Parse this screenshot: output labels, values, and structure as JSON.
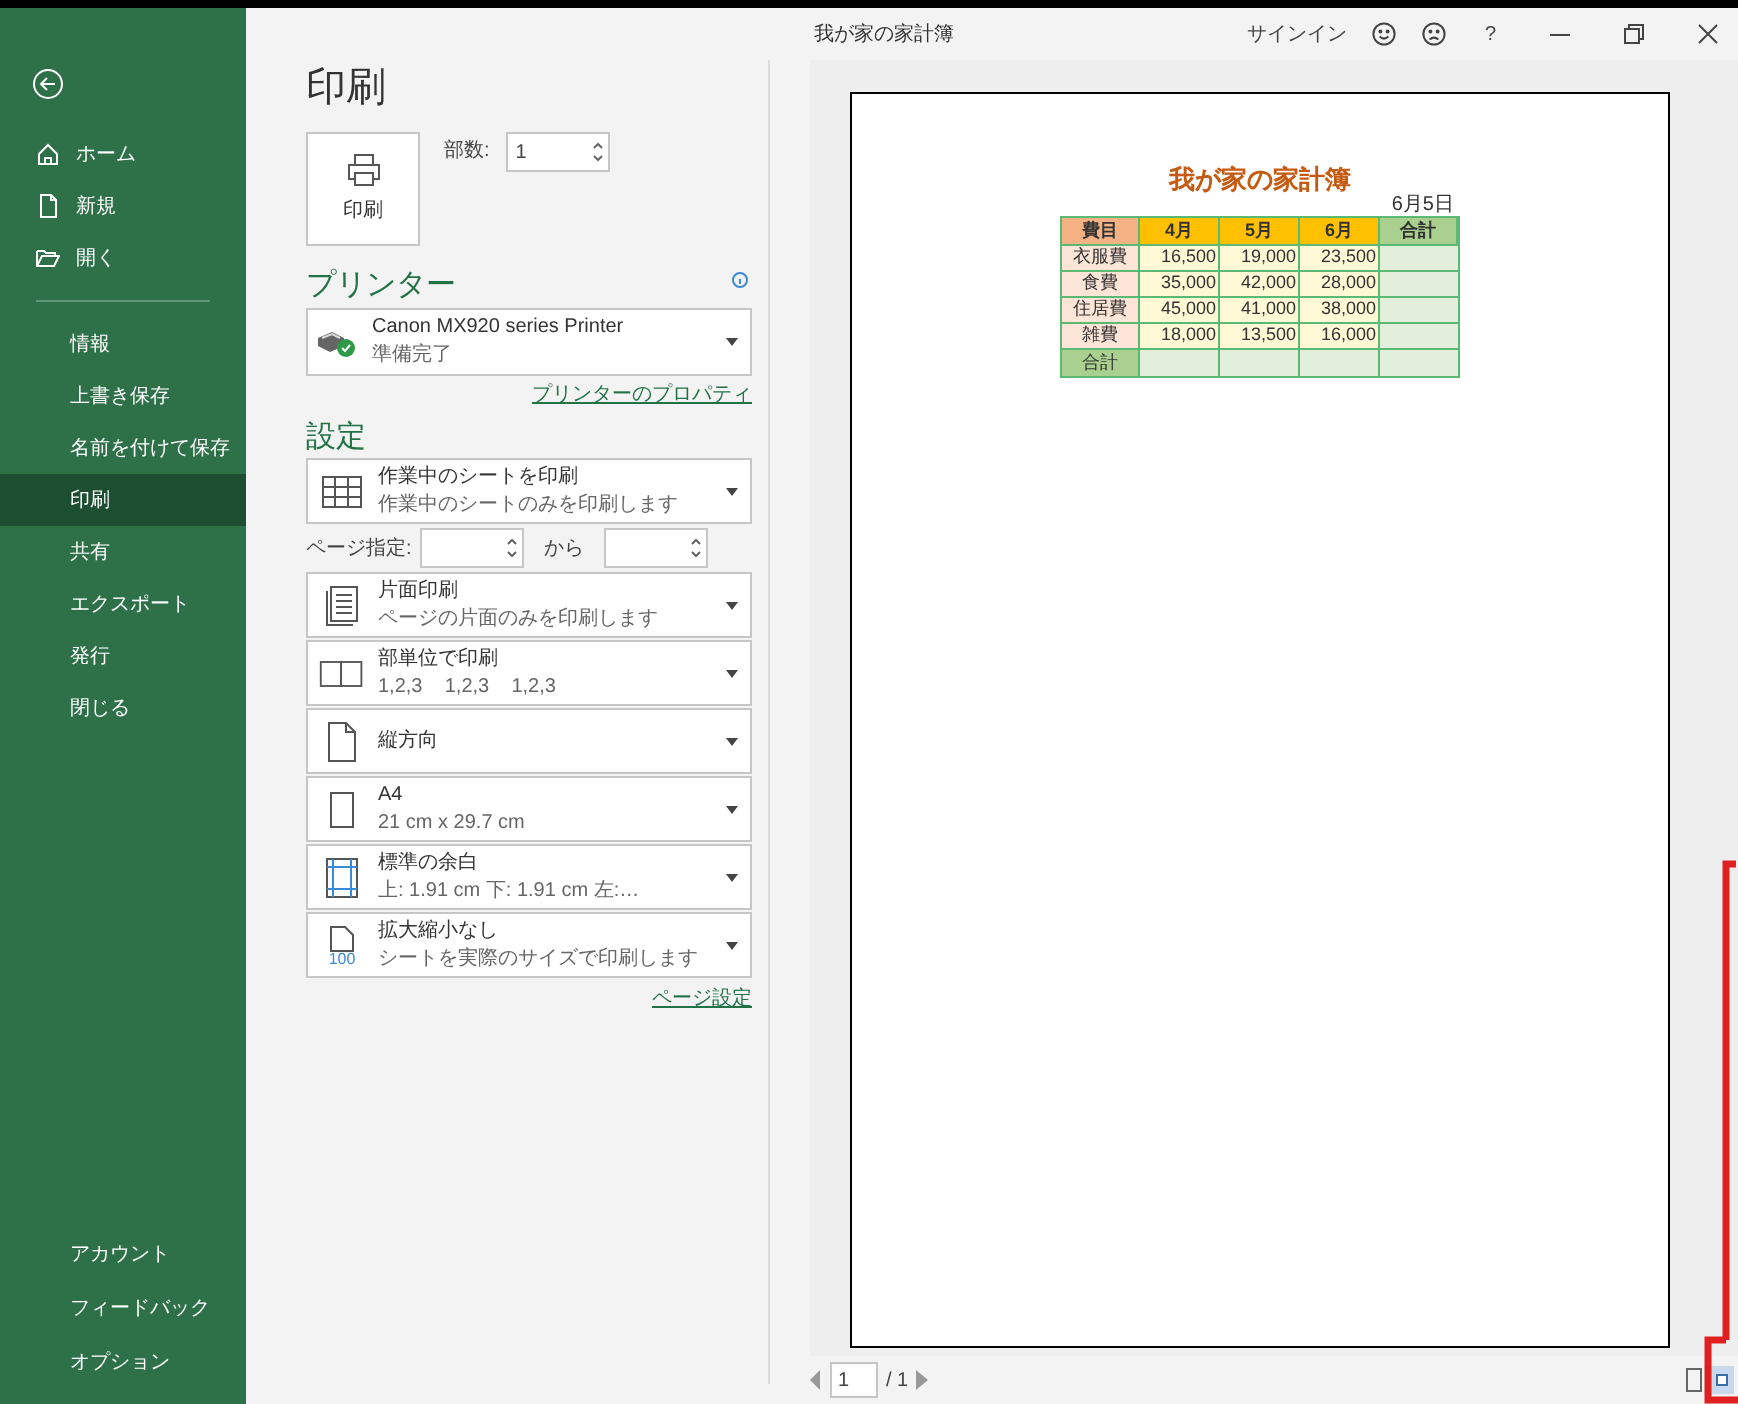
{
  "window": {
    "title": "我が家の家計簿",
    "sign_in": "サインイン",
    "help": "?"
  },
  "sidebar": {
    "top_items": [
      {
        "label": "ホーム",
        "selected": false
      },
      {
        "label": "新規",
        "selected": false
      },
      {
        "label": "開く",
        "selected": false
      }
    ],
    "items": [
      {
        "label": "情報",
        "selected": false
      },
      {
        "label": "上書き保存",
        "selected": false
      },
      {
        "label": "名前を付けて保存",
        "selected": false
      },
      {
        "label": "印刷",
        "selected": true
      },
      {
        "label": "共有",
        "selected": false
      },
      {
        "label": "エクスポート",
        "selected": false
      },
      {
        "label": "発行",
        "selected": false
      },
      {
        "label": "閉じる",
        "selected": false
      }
    ],
    "bottom_items": [
      {
        "label": "アカウント",
        "selected": false
      },
      {
        "label": "フィードバック",
        "selected": false
      },
      {
        "label": "オプション",
        "selected": false
      }
    ]
  },
  "print": {
    "heading": "印刷",
    "button": "印刷",
    "copies_label": "部数:",
    "copies": "1"
  },
  "printer": {
    "heading": "プリンター",
    "name": "Canon MX920 series Printer",
    "status": "準備完了",
    "properties_link": "プリンターのプロパティ"
  },
  "settings": {
    "heading": "設定",
    "items": [
      {
        "kind": "dropdown",
        "title": "作業中のシートを印刷",
        "subtitle": "作業中のシートのみを印刷します"
      },
      {
        "kind": "page_range",
        "label": "ページ指定:",
        "to": "から"
      },
      {
        "kind": "dropdown",
        "title": "片面印刷",
        "subtitle": "ページの片面のみを印刷します"
      },
      {
        "kind": "dropdown",
        "title": "部単位で印刷",
        "subtitle": "1,2,3    1,2,3    1,2,3"
      },
      {
        "kind": "dropdown",
        "title": "縦方向"
      },
      {
        "kind": "dropdown",
        "title": "A4",
        "subtitle": "21 cm x 29.7 cm"
      },
      {
        "kind": "dropdown",
        "title": "標準の余白",
        "subtitle": "上: 1.91 cm 下: 1.91 cm 左:…"
      },
      {
        "kind": "dropdown",
        "title": "拡大縮小なし",
        "subtitle": "シートを実際のサイズで印刷します",
        "icon_text": "100"
      }
    ],
    "page_setup_link": "ページ設定"
  },
  "preview": {
    "sheet_title": "我が家の家計簿",
    "date": "6月5日",
    "columns": [
      "費目",
      "4月",
      "5月",
      "6月",
      "合計"
    ],
    "rows": [
      [
        "衣服費",
        "16,500",
        "19,000",
        "23,500"
      ],
      [
        "食費",
        "35,000",
        "42,000",
        "28,000"
      ],
      [
        "住居費",
        "45,000",
        "41,000",
        "38,000"
      ],
      [
        "雑費",
        "18,000",
        "13,500",
        "16,000"
      ]
    ],
    "total_label": "合計",
    "page": "1",
    "page_count": "/ 1"
  }
}
